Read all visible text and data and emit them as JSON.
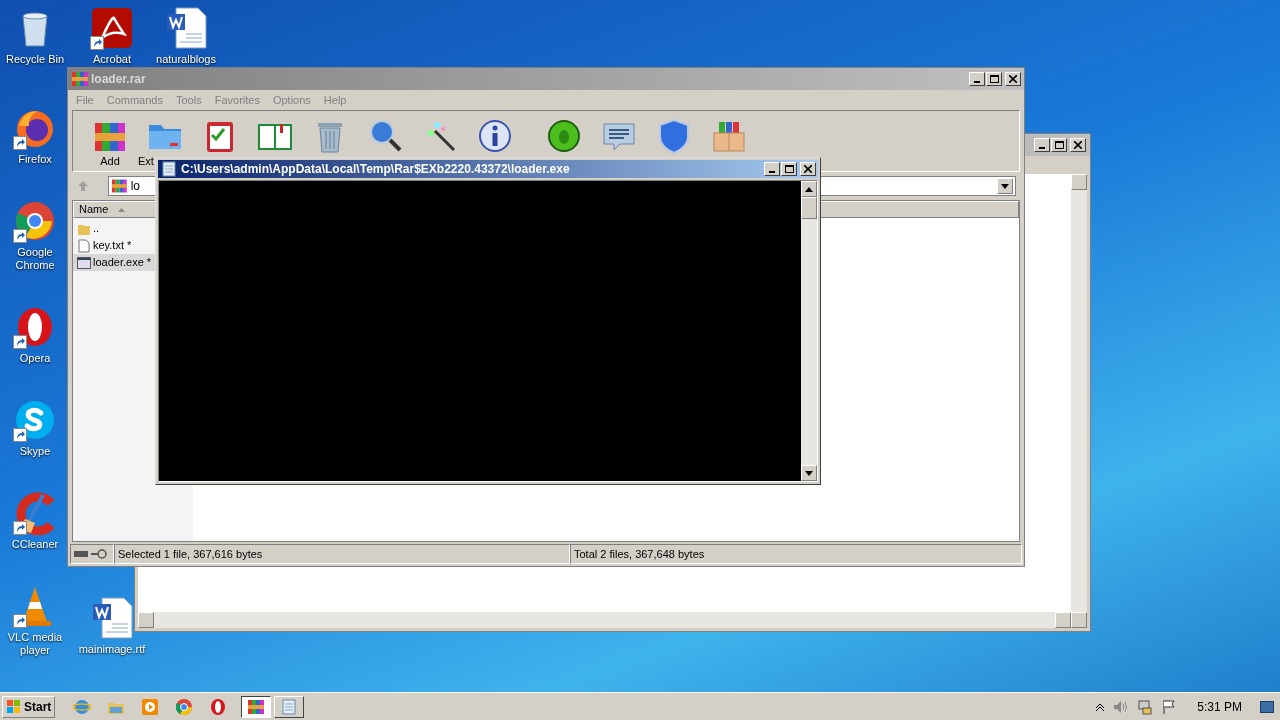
{
  "desktop_icons": [
    {
      "label": "Recycle Bin",
      "kind": "recycle",
      "shortcut": false
    },
    {
      "label": "Firefox",
      "kind": "firefox",
      "shortcut": true
    },
    {
      "label": "Google Chrome",
      "kind": "chrome",
      "shortcut": true
    },
    {
      "label": "Opera",
      "kind": "opera",
      "shortcut": true
    },
    {
      "label": "Skype",
      "kind": "skype",
      "shortcut": true
    },
    {
      "label": "CCleaner",
      "kind": "ccleaner",
      "shortcut": true
    },
    {
      "label": "VLC media player",
      "kind": "vlc",
      "shortcut": true
    }
  ],
  "desktop_icons_col2": [
    {
      "label": "Acrobat",
      "kind": "acrobat",
      "shortcut": true
    },
    {
      "label": "naturalblogs",
      "kind": "word",
      "shortcut": false
    },
    {
      "label": "mainimage.rtf",
      "kind": "word",
      "shortcut": false
    }
  ],
  "winrar": {
    "title": "loader.rar",
    "menu": [
      "File",
      "Commands",
      "Tools",
      "Favorites",
      "Options",
      "Help"
    ],
    "toolbar": [
      {
        "kind": "add",
        "label": "Add"
      },
      {
        "kind": "extract",
        "label": "Ext"
      },
      {
        "kind": "test"
      },
      {
        "kind": "view"
      },
      {
        "kind": "delete"
      },
      {
        "kind": "find"
      },
      {
        "kind": "wizard"
      },
      {
        "kind": "info"
      },
      {
        "kind": "virus"
      },
      {
        "kind": "comment"
      },
      {
        "kind": "protect"
      },
      {
        "kind": "sfx"
      }
    ],
    "address": "lo",
    "column": "Name",
    "files": [
      {
        "name": "..",
        "kind": "folder",
        "selected": false
      },
      {
        "name": "key.txt *",
        "kind": "text",
        "selected": false
      },
      {
        "name": "loader.exe *",
        "kind": "exe",
        "selected": true
      }
    ],
    "status_left": "Selected 1 file, 367,616 bytes",
    "status_right": "Total 2 files, 367,648 bytes"
  },
  "console": {
    "title": "C:\\Users\\admin\\AppData\\Local\\Temp\\Rar$EXb2220.43372\\loader.exe"
  },
  "taskbar": {
    "start": "Start",
    "quick_launch": [
      {
        "kind": "ie"
      },
      {
        "kind": "explorer"
      },
      {
        "kind": "media"
      },
      {
        "kind": "chrome"
      },
      {
        "kind": "opera"
      }
    ],
    "tasks": [
      {
        "kind": "winrar",
        "selected": true
      },
      {
        "kind": "notepad",
        "selected": false
      }
    ],
    "time": "5:31 PM"
  }
}
